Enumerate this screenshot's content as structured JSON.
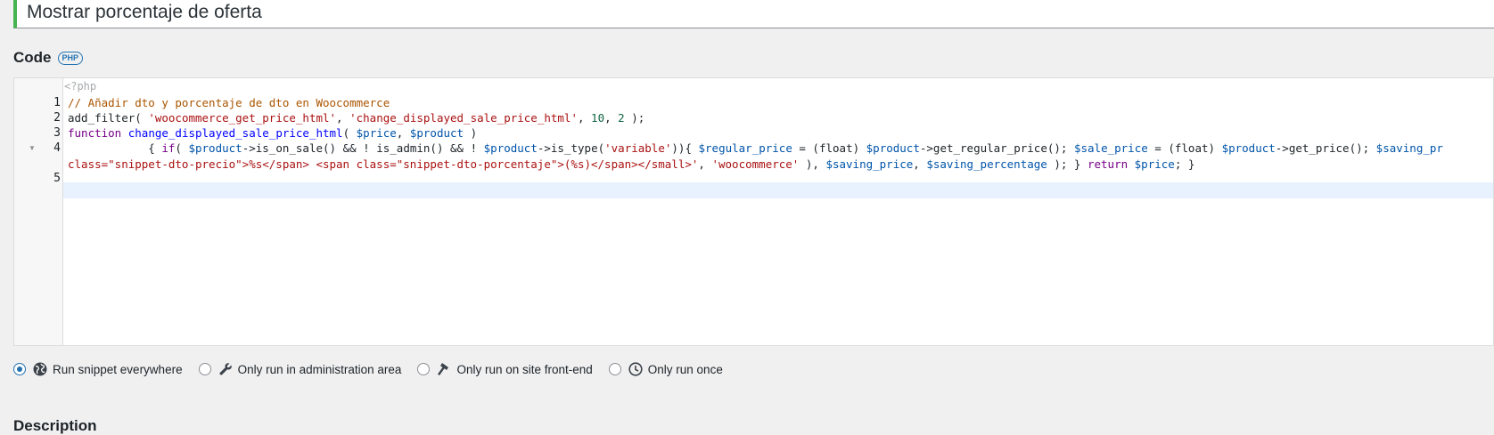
{
  "snippet": {
    "title": "Mostrar porcentaje de oferta"
  },
  "code_section": {
    "heading": "Code",
    "badge": "PHP",
    "opening_tag": "<?php",
    "line_numbers": [
      "1",
      "2",
      "3",
      "4",
      "5"
    ],
    "lines": {
      "l1": {
        "comment": "// Añadir dto y porcentaje de dto en Woocommerce"
      },
      "l2": {
        "fn": "add_filter",
        "p1": "( ",
        "s1": "'woocommerce_get_price_html'",
        "p2": ", ",
        "s2": "'change_displayed_sale_price_html'",
        "p3": ", ",
        "n1": "10",
        "p4": ", ",
        "n2": "2",
        "p5": " );"
      },
      "l3": {
        "kw": "function",
        "sp": " ",
        "def": "change_displayed_sale_price_html",
        "p1": "( ",
        "v1": "$price",
        "p2": ", ",
        "v2": "$product",
        "p3": " )"
      },
      "l4": {
        "indent": "            { ",
        "kw_if": "if",
        "p1": "( ",
        "v1": "$product",
        "t1": "->is_on_sale() && ! is_admin() && ! ",
        "v2": "$product",
        "t2": "->is_type(",
        "s1": "'variable'",
        "t3": ")){ ",
        "v3": "$regular_price",
        "t4": " = (float) ",
        "v4": "$product",
        "t5": "->get_regular_price(); ",
        "v5": "$sale_price",
        "t6": " = (float) ",
        "v6": "$product",
        "t7": "->get_price(); ",
        "v7": "$saving_pr"
      },
      "l4_wrap": {
        "s1": "class=\"snippet-dto-precio\">%s</span> <span class=\"snippet-dto-porcentaje\">(%s)</span></small>'",
        "t1": ", ",
        "s2": "'woocommerce'",
        "t2": " ), ",
        "v1": "$saving_price",
        "t3": ", ",
        "v2": "$saving_percentage",
        "t4": " ); } ",
        "kw_return": "return",
        "t5": " ",
        "v3": "$price",
        "t6": "; }"
      }
    }
  },
  "run_options": {
    "everywhere": "Run snippet everywhere",
    "admin": "Only run in administration area",
    "frontend": "Only run on site front-end",
    "once": "Only run once",
    "selected": "everywhere"
  },
  "description_section": {
    "heading": "Description"
  },
  "colors": {
    "accent_green": "#46b450",
    "wp_blue": "#2271b1",
    "comment": "#aa5500",
    "string": "#aa1111",
    "number": "#116644",
    "keyword": "#770088",
    "variable": "#0055aa",
    "definition": "#0000ff"
  }
}
